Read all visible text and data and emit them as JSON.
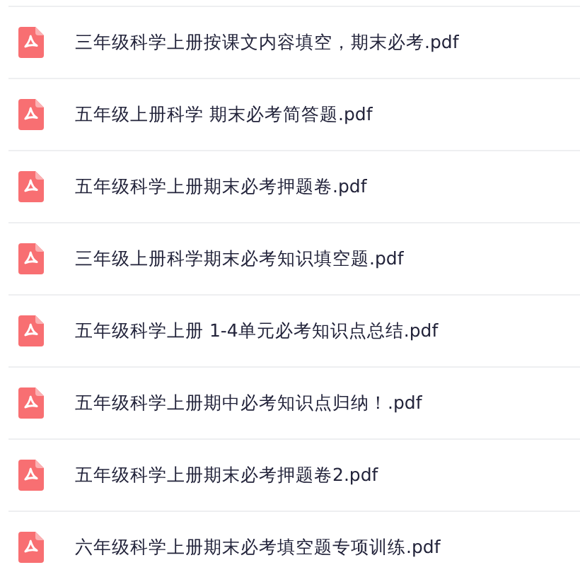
{
  "files": [
    {
      "name": "三年级科学上册按课文内容填空，期末必考.pdf"
    },
    {
      "name": "五年级上册科学 期末必考简答题.pdf"
    },
    {
      "name": "五年级科学上册期末必考押题卷.pdf"
    },
    {
      "name": "三年级上册科学期末必考知识填空题.pdf"
    },
    {
      "name": "五年级科学上册 1-4单元必考知识点总结.pdf"
    },
    {
      "name": "五年级科学上册期中必考知识点归纳！.pdf"
    },
    {
      "name": "五年级科学上册期末必考押题卷2.pdf"
    },
    {
      "name": "六年级科学上册期末必考填空题专项训练.pdf"
    }
  ]
}
